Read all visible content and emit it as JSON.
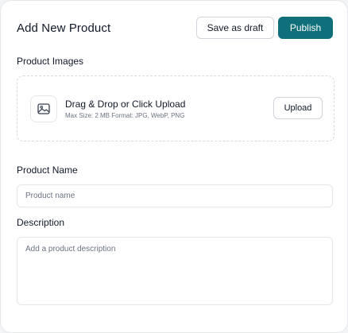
{
  "header": {
    "title": "Add New Product",
    "save_draft_label": "Save as draft",
    "publish_label": "Publish"
  },
  "images": {
    "label": "Product Images",
    "dropzone_title": "Drag & Drop or Click Upload",
    "dropzone_hint": "Max Size: 2 MB Format: JPG, WebP, PNG",
    "upload_label": "Upload",
    "icon": "image-icon"
  },
  "name": {
    "label": "Product Name",
    "placeholder": "Product name",
    "value": ""
  },
  "description": {
    "label": "Description",
    "placeholder": "Add a product description",
    "value": ""
  },
  "colors": {
    "accent": "#0f6f7a",
    "border": "#e5e7eb"
  }
}
